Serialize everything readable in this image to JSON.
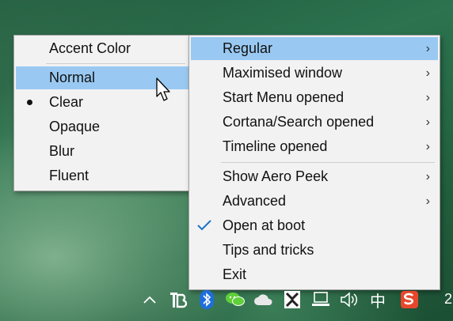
{
  "main_menu": {
    "items": [
      {
        "label": "Regular",
        "arrow": "›",
        "highlighted": true
      },
      {
        "label": "Maximised window",
        "arrow": "›"
      },
      {
        "label": "Start Menu opened",
        "arrow": "›"
      },
      {
        "label": "Cortana/Search opened",
        "arrow": "›"
      },
      {
        "label": "Timeline opened",
        "arrow": "›"
      },
      {
        "label": "Show Aero Peek",
        "arrow": "›"
      },
      {
        "label": "Advanced",
        "arrow": "›"
      },
      {
        "label": "Open at boot",
        "checked": true
      },
      {
        "label": "Tips and tricks"
      },
      {
        "label": "Exit"
      }
    ]
  },
  "sub_menu": {
    "header": "Accent Color",
    "items": [
      {
        "label": "Normal",
        "highlighted": true
      },
      {
        "label": "Clear",
        "selected": true
      },
      {
        "label": "Opaque"
      },
      {
        "label": "Blur"
      },
      {
        "label": "Fluent"
      }
    ]
  },
  "taskbar": {
    "icons": [
      "chevron-up-icon",
      "translucenttb-icon",
      "bluetooth-icon",
      "wechat-icon",
      "onedrive-icon",
      "network-app-icon",
      "network-icon",
      "volume-icon",
      "ime-chinese-icon",
      "sogou-icon"
    ],
    "ime_label": "中",
    "clock_fragment": "2"
  },
  "colors": {
    "menu_bg": "#f2f2f2",
    "highlight": "#99c9f2",
    "check": "#1a73c8"
  }
}
